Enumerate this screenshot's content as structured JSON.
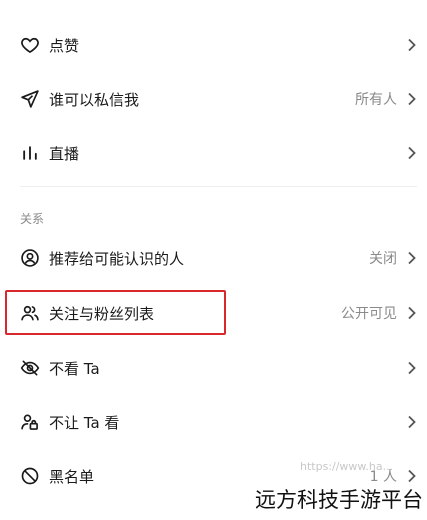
{
  "rows": [
    {
      "label": "点赞",
      "value": "",
      "icon": "heart-icon"
    },
    {
      "label": "谁可以私信我",
      "value": "所有人",
      "icon": "send-icon"
    },
    {
      "label": "直播",
      "value": "",
      "icon": "live-bars-icon"
    },
    {
      "label": "推荐给可能认识的人",
      "value": "关闭",
      "icon": "user-circle-icon"
    },
    {
      "label": "关注与粉丝列表",
      "value": "公开可见",
      "icon": "users-icon"
    },
    {
      "label": "不看 Ta",
      "value": "",
      "icon": "eye-off-icon"
    },
    {
      "label": "不让 Ta 看",
      "value": "",
      "icon": "user-lock-icon"
    },
    {
      "label": "黑名单",
      "value": "1 人",
      "icon": "block-icon"
    }
  ],
  "section": {
    "title": "关系"
  },
  "watermark": {
    "text": "远方科技手游平台",
    "url": "https://www.ha..."
  },
  "colors": {
    "highlight": "#d9272e",
    "muted": "#8a8a8a",
    "text": "#1a1a1a"
  }
}
